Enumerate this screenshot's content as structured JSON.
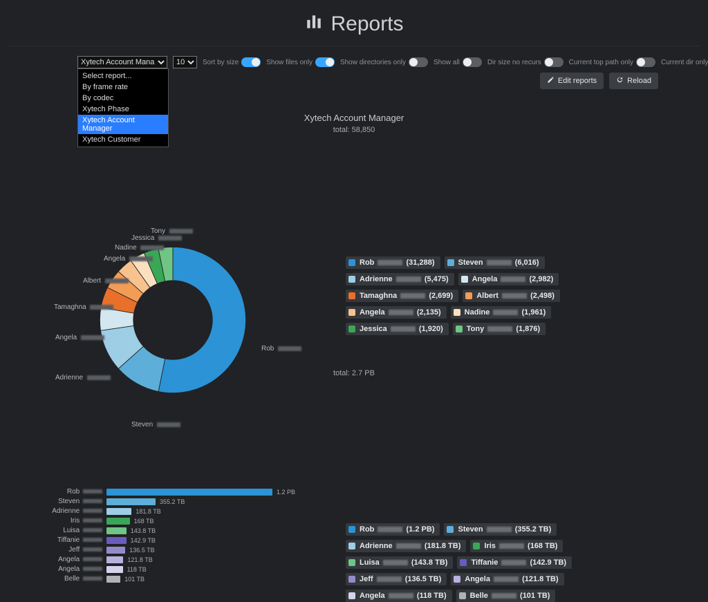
{
  "header": {
    "title": "Reports"
  },
  "controls": {
    "report_select_display": "Xytech Account Mana",
    "limit_select": "10",
    "toggles": [
      {
        "label": "Sort by size",
        "on": true
      },
      {
        "label": "Show files only",
        "on": true
      },
      {
        "label": "Show directories only",
        "on": false
      },
      {
        "label": "Show all",
        "on": false
      },
      {
        "label": "Dir size no recurs",
        "on": false
      },
      {
        "label": "Current top path only",
        "on": false
      },
      {
        "label": "Current dir only",
        "on": false
      }
    ],
    "dropdown_options": [
      "Select report...",
      "By frame rate",
      "By codec",
      "Xytech Phase",
      "Xytech Account Manager",
      "Xytech Customer"
    ],
    "dropdown_highlight_index": 4,
    "buttons": {
      "edit": "Edit reports",
      "reload": "Reload"
    }
  },
  "chart_data": [
    {
      "type": "pie",
      "variant": "donut",
      "title": "Xytech Account Manager",
      "subtitle": "total: 58,850",
      "series": [
        {
          "name": "Rob",
          "value": 31288,
          "value_label": "(31,288)",
          "color": "#2b93d6"
        },
        {
          "name": "Steven",
          "value": 6016,
          "value_label": "(6,016)",
          "color": "#5daed9"
        },
        {
          "name": "Adrienne",
          "value": 5475,
          "value_label": "(5,475)",
          "color": "#9ecde6"
        },
        {
          "name": "Angela",
          "value": 2982,
          "value_label": "(2,982)",
          "color": "#d3e7f0"
        },
        {
          "name": "Tamaghna",
          "value": 2699,
          "value_label": "(2,699)",
          "color": "#e8702a"
        },
        {
          "name": "Albert",
          "value": 2498,
          "value_label": "(2,498)",
          "color": "#f29c55"
        },
        {
          "name": "Angela",
          "value": 2135,
          "value_label": "(2,135)",
          "color": "#f7c28d"
        },
        {
          "name": "Nadine",
          "value": 1961,
          "value_label": "(1,961)",
          "color": "#fbe0bf"
        },
        {
          "name": "Jessica",
          "value": 1920,
          "value_label": "(1,920)",
          "color": "#3aa757"
        },
        {
          "name": "Tony",
          "value": 1876,
          "value_label": "(1,876)",
          "color": "#6fc585"
        }
      ]
    },
    {
      "type": "bar",
      "orientation": "horizontal",
      "subtitle": "total: 2.7 PB",
      "max_value": 1200,
      "series": [
        {
          "name": "Rob",
          "value": 1200,
          "value_label": "1.2 PB",
          "legend_label": "(1.2 PB)",
          "color": "#2b93d6"
        },
        {
          "name": "Steven",
          "value": 355.2,
          "value_label": "355.2 TB",
          "legend_label": "(355.2 TB)",
          "color": "#5daed9"
        },
        {
          "name": "Adrienne",
          "value": 181.8,
          "value_label": "181.8 TB",
          "legend_label": "(181.8 TB)",
          "color": "#9ecde6"
        },
        {
          "name": "Iris",
          "value": 168,
          "value_label": "168 TB",
          "legend_label": "(168 TB)",
          "color": "#3aa757"
        },
        {
          "name": "Luisa",
          "value": 143.8,
          "value_label": "143.8 TB",
          "legend_label": "(143.8 TB)",
          "color": "#6fc585"
        },
        {
          "name": "Tiffanie",
          "value": 142.9,
          "value_label": "142.9 TB",
          "legend_label": "(142.9 TB)",
          "color": "#6a5bbd"
        },
        {
          "name": "Jeff",
          "value": 136.5,
          "value_label": "136.5 TB",
          "legend_label": "(136.5 TB)",
          "color": "#948acb"
        },
        {
          "name": "Angela",
          "value": 121.8,
          "value_label": "121.8 TB",
          "legend_label": "(121.8 TB)",
          "color": "#b8b1de"
        },
        {
          "name": "Angela",
          "value": 118,
          "value_label": "118 TB",
          "legend_label": "(118 TB)",
          "color": "#d6d2ed"
        },
        {
          "name": "Belle",
          "value": 101,
          "value_label": "101 TB",
          "legend_label": "(101 TB)",
          "color": "#b0b2b5"
        }
      ]
    }
  ]
}
